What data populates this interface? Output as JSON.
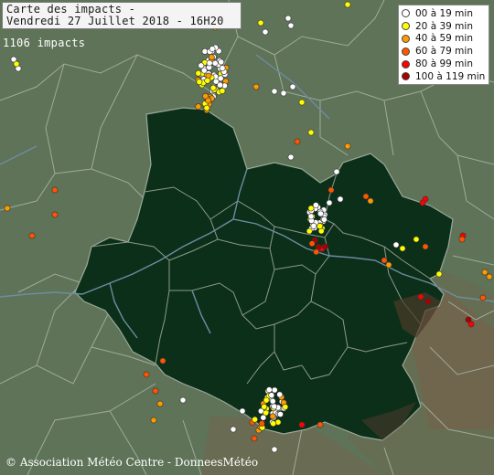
{
  "header": {
    "title_line1": "Carte des impacts -",
    "title_line2": "Vendredi 27 Juillet 2018 - 16H20"
  },
  "impact_count": "1106 impacts",
  "legend": {
    "items": [
      {
        "label": "00 à 19 min",
        "color": "#ffffff"
      },
      {
        "label": "20 à 39 min",
        "color": "#ffff00"
      },
      {
        "label": "40 à 59 min",
        "color": "#ff9900"
      },
      {
        "label": "60 à 79 min",
        "color": "#ff5500"
      },
      {
        "label": "80 à 99 min",
        "color": "#ff0000"
      },
      {
        "label": "100 à 119 min",
        "color": "#aa0000"
      }
    ]
  },
  "copyright": "© Association Météo Centre - DonneesMétéo",
  "colors": {
    "surroundings": "#5e7358",
    "region_fill": "#0c2f19",
    "borders": "#a9b6a6",
    "river": "#6e8ca2",
    "relief": "#8a5a46"
  }
}
